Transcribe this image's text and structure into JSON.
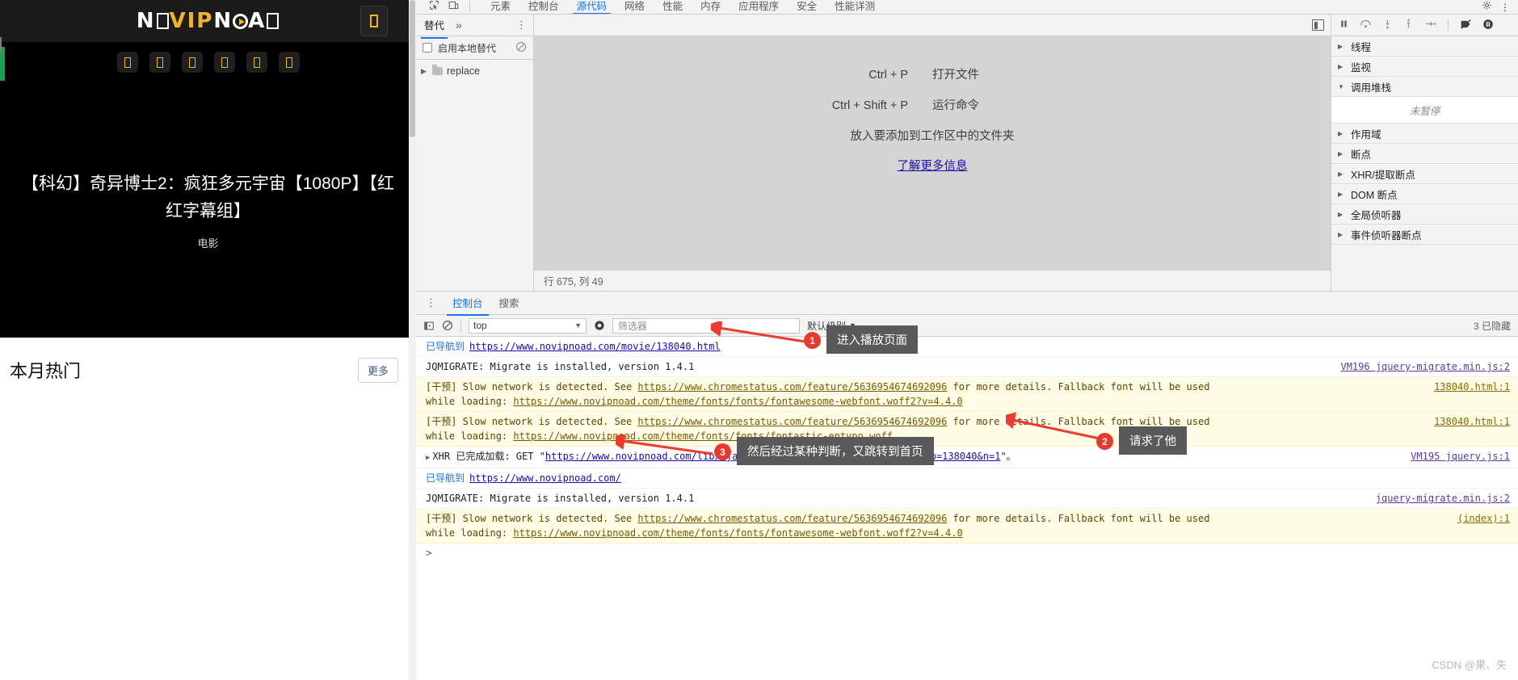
{
  "website": {
    "logo": {
      "text": "NOVIPNOAD",
      "accent_color": "#f0b429"
    },
    "header_button": "menu-box",
    "nav_chips_count": 6,
    "hero": {
      "title": "【科幻】奇异博士2：疯狂多元宇宙【1080P】【红\n红字幕组】",
      "title_line1": "【科幻】奇异博士2：疯狂多元宇宙【1080P】【红",
      "title_line2": "红字幕组】",
      "subtitle": "电影"
    },
    "section": {
      "title": "本月热门",
      "more_label": "更多"
    }
  },
  "devtools": {
    "main_tabs": [
      {
        "label": "元素",
        "selected": false
      },
      {
        "label": "控制台",
        "selected": false
      },
      {
        "label": "源代码",
        "selected": true
      },
      {
        "label": "网络",
        "selected": false
      },
      {
        "label": "性能",
        "selected": false
      },
      {
        "label": "内存",
        "selected": false
      },
      {
        "label": "应用程序",
        "selected": false
      },
      {
        "label": "安全",
        "selected": false
      },
      {
        "label": "性能详测",
        "selected": false
      }
    ],
    "navigator": {
      "tab_label": "替代",
      "overflow_label": "»",
      "more_menu": "⋮",
      "checkbox_label": "启用本地替代",
      "clear_icon": "no-entry-icon",
      "tree_items": [
        {
          "label": "replace",
          "type": "folder"
        }
      ]
    },
    "editor": {
      "hints": [
        {
          "key": "Ctrl + P",
          "desc": "打开文件"
        },
        {
          "key": "Ctrl + Shift + P",
          "desc": "运行命令"
        }
      ],
      "drop_hint": "放入要添加到工作区中的文件夹",
      "learn_more": "了解更多信息",
      "status": "行 675, 列 49"
    },
    "debugger": {
      "toolbar_icons": [
        "pause-icon",
        "step-over-icon",
        "step-into-icon",
        "step-out-icon",
        "step-icon",
        "deactivate-breakpoints-icon",
        "pause-on-exceptions-icon"
      ],
      "sections": [
        {
          "label": "线程",
          "expanded": false
        },
        {
          "label": "监视",
          "expanded": false
        },
        {
          "label": "调用堆栈",
          "expanded": true,
          "empty_text": "未暂停"
        },
        {
          "label": "作用域",
          "expanded": false
        },
        {
          "label": "断点",
          "expanded": false
        },
        {
          "label": "XHR/提取断点",
          "expanded": false
        },
        {
          "label": "DOM 断点",
          "expanded": false
        },
        {
          "label": "全局侦听器",
          "expanded": false
        },
        {
          "label": "事件侦听器断点",
          "expanded": false
        }
      ]
    },
    "console": {
      "tabs": [
        {
          "label": "控制台",
          "selected": true
        },
        {
          "label": "搜索",
          "selected": false
        }
      ],
      "context": "top",
      "filter_placeholder": "筛选器",
      "level": "默认级别",
      "hidden_text": "3 已隐藏",
      "prompt": ">",
      "messages": [
        {
          "type": "navigation",
          "tag": "已导航到",
          "link": "https://www.novipnoad.com/movie/138040.html",
          "source": ""
        },
        {
          "type": "log",
          "text": "JQMIGRATE: Migrate is installed, version 1.4.1",
          "source": "VM196 jquery-migrate.min.js:2"
        },
        {
          "type": "warning",
          "prefix": "[干预] Slow network is detected. See ",
          "link1": "https://www.chromestatus.com/feature/5636954674692096",
          "middle": " for more details. Fallback font will be used ",
          "line2_prefix": "while loading: ",
          "link2": "https://www.novipnoad.com/theme/fonts/fonts/fontawesome-webfont.woff2?v=4.4.0",
          "source": "138040.html:1"
        },
        {
          "type": "warning",
          "prefix": "[干预] Slow network is detected. See ",
          "link1": "https://www.chromestatus.com/feature/5636954674692096",
          "middle": " for more details. Fallback font will be used ",
          "line2_prefix": "while loading: ",
          "link2": "https://www.novipnoad.com/theme/fonts/fonts/fontastic-entypo.woff",
          "source": "138040.html:1"
        },
        {
          "type": "xhr",
          "prefix": "XHR 已完成加载: GET \"",
          "link": "https://www.novipnoad.com/lib/ajax.php?action=bawpvc-ajax-counter&p=138040&n=1",
          "suffix": "\"。",
          "source": "VM195 jquery.js:1"
        },
        {
          "type": "navigation",
          "tag": "已导航到",
          "link": "https://www.novipnoad.com/",
          "source": ""
        },
        {
          "type": "log",
          "text": "JQMIGRATE: Migrate is installed, version 1.4.1",
          "source": "jquery-migrate.min.js:2"
        },
        {
          "type": "warning",
          "prefix": "[干预] Slow network is detected. See ",
          "link1": "https://www.chromestatus.com/feature/5636954674692096",
          "middle": " for more details. Fallback font will be used ",
          "line2_prefix": "while loading: ",
          "link2": "https://www.novipnoad.com/theme/fonts/fonts/fontawesome-webfont.woff2?v=4.4.0",
          "source": "(index):1"
        }
      ]
    }
  },
  "annotations": [
    {
      "number": "1",
      "text": "进入播放页面"
    },
    {
      "number": "2",
      "text": "请求了他"
    },
    {
      "number": "3",
      "text": "然后经过某种判断，又跳转到首页"
    }
  ],
  "watermark": "CSDN @果、失"
}
